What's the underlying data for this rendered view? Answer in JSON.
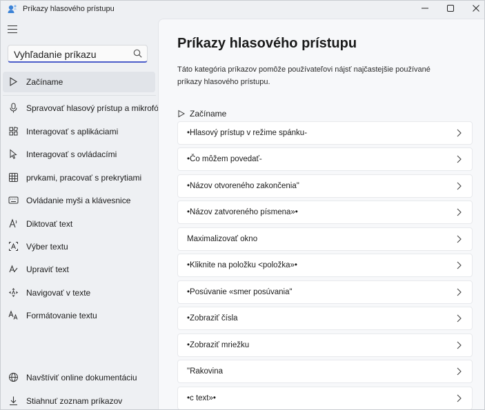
{
  "window": {
    "title": "Príkazy hlasového prístupu",
    "controls": {
      "minimize": "—",
      "maximize": "☐",
      "close": "✕"
    }
  },
  "search": {
    "placeholder": "Vyhľadanie príkazu"
  },
  "sidebar": {
    "items": [
      {
        "label": "Začíname",
        "icon": "play-outline-icon",
        "selected": true
      },
      {
        "label": "Spravovať hlasový prístup a mikrofón",
        "icon": "microphone-icon"
      },
      {
        "label": "Interagovať s aplikáciami",
        "icon": "apps-grid-icon"
      },
      {
        "label": "Interagovať s ovládacími",
        "icon": "cursor-pointer-icon"
      },
      {
        "label": "prvkami, pracovať s prekrytiami",
        "icon": "grid-overlay-icon"
      },
      {
        "label": "Ovládanie myši a klávesnice",
        "icon": "mouse-keyboard-icon"
      },
      {
        "label": "Diktovať text",
        "icon": "dictate-text-icon"
      },
      {
        "label": "Výber textu",
        "icon": "select-text-icon"
      },
      {
        "label": "Upraviť text",
        "icon": "edit-text-icon"
      },
      {
        "label": "Navigovať v texte",
        "icon": "navigate-text-icon"
      },
      {
        "label": "Formátovanie textu",
        "icon": "format-text-icon"
      }
    ],
    "footer": [
      {
        "label": "Navštíviť online dokumentáciu",
        "icon": "globe-icon"
      },
      {
        "label": "Stiahnuť zoznam príkazov",
        "icon": "download-icon"
      }
    ]
  },
  "main": {
    "title": "Príkazy hlasového prístupu",
    "description": "Táto kategória príkazov pomôže používateľovi nájsť najčastejšie používané príkazy hlasového prístupu.",
    "section_label": "Začíname",
    "commands": [
      "•Hlasový prístup v režime spánku-",
      "•Čo môžem povedať-",
      "•Názov otvoreného zakončenia\"",
      "•Názov zatvoreného písmena»•",
      "Maximalizovať okno",
      "•Kliknite na položku <položka»•",
      "•Posúvanie «smer posúvania\"",
      "•Zobraziť čísla",
      "•Zobraziť mriežku",
      "\"Rakovina",
      "•c text»•"
    ]
  },
  "colors": {
    "accent": "#4a5cc9",
    "selected_bg": "#e1e4e9",
    "pane_bg": "#f7f8fa"
  }
}
